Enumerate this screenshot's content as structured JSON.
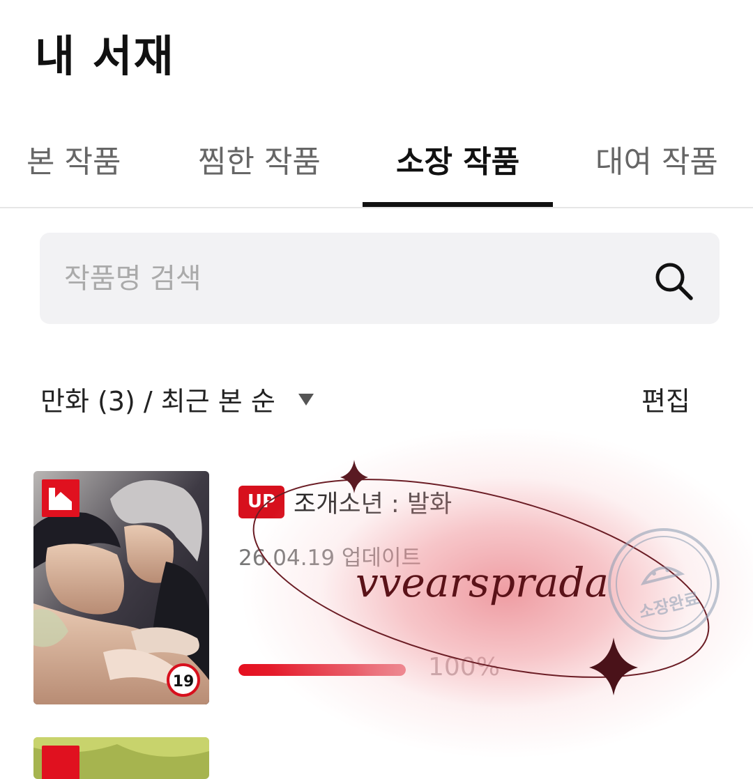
{
  "header": {
    "title": "내 서재"
  },
  "tabs": [
    {
      "label": "본 작품"
    },
    {
      "label": "찜한 작품"
    },
    {
      "label": "소장 작품",
      "active": true
    },
    {
      "label": "대여 작품"
    }
  ],
  "search": {
    "placeholder": "작품명 검색",
    "value": "",
    "icon": "search-icon"
  },
  "filter": {
    "label": "만화 (3) / 최근 본 순",
    "icon": "caret-down-icon"
  },
  "edit": {
    "label": "편집"
  },
  "books": [
    {
      "badge": "UP",
      "title": "조개소년 : 발화",
      "updated": "26.04.19 업데이트",
      "progress_percent": 100,
      "progress_label": "100%",
      "age_rating": "19",
      "publisher_logo": "red-logo-icon"
    }
  ],
  "overlay": {
    "signature": "vvearsprada",
    "stamp_text": "소장완료"
  },
  "colors": {
    "accent_red": "#d7101d",
    "tab_underline": "#111111",
    "search_bg": "#f2f2f4",
    "glow_pink": "#ec8d95",
    "signature_color": "#5a1218"
  }
}
